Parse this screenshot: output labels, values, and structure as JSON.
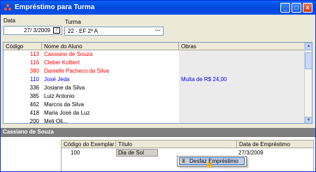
{
  "window": {
    "title": "Empréstimo para Turma",
    "colors": {
      "titlebar": "#0a5ef0",
      "red_text": "#ff0000",
      "blue_text": "#0000ff"
    }
  },
  "window_buttons": {
    "minimize": "minimize-icon",
    "maximize": "maximize-icon",
    "close": "close-icon"
  },
  "form": {
    "data_label": "Data",
    "data_value": "27/ 3/2009",
    "turma_label": "Turma",
    "turma_value": "22 - EF 2º A"
  },
  "grid": {
    "columns": [
      "Código",
      "Nome do Aluno",
      "Obras"
    ],
    "rows": [
      {
        "codigo": "113",
        "nome": "Cassiano de Souza",
        "obras": "",
        "color": "#ff0000"
      },
      {
        "codigo": "116",
        "nome": "Cleber Kolbert",
        "obras": "",
        "color": "#ff0000"
      },
      {
        "codigo": "380",
        "nome": "Danielle Pacheco da Silva",
        "obras": "",
        "color": "#ff0000"
      },
      {
        "codigo": "110",
        "nome": "José Jeda",
        "obras": "Multa de R$ 24,00",
        "color": "#0000ff"
      },
      {
        "codigo": "336",
        "nome": "Josiane da Silva",
        "obras": "",
        "color": "#000000"
      },
      {
        "codigo": "385",
        "nome": "Luiz Antonio",
        "obras": "",
        "color": "#000000"
      },
      {
        "codigo": "462",
        "nome": "Marcos da Silva",
        "obras": "",
        "color": "#000000"
      },
      {
        "codigo": "418",
        "nome": "Maria José da Luz",
        "obras": "",
        "color": "#000000"
      },
      {
        "codigo": "200",
        "nome": "Meli Oli...",
        "obras": "",
        "color": "#000000"
      }
    ]
  },
  "detail": {
    "student_name": "Cassiano de Souza",
    "columns": [
      "Código do Exemplar",
      "Título",
      "Data de Empréstimo"
    ],
    "rows": [
      {
        "codigo": "100",
        "titulo": "Dia de Sol",
        "data": "27/3/2009"
      }
    ]
  },
  "context_menu": {
    "item": "Desfaz Empréstimo"
  }
}
